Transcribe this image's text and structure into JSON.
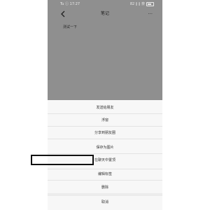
{
  "status_bar": {
    "left": "Tu ⓘ 17:27",
    "right": "82 ∥ ∥ 奈"
  },
  "nav": {
    "title": "笔记",
    "more": "···"
  },
  "note": {
    "content": "测试一下"
  },
  "sheet": {
    "items": [
      {
        "label": "发送给朋友"
      },
      {
        "label": "浮窗"
      },
      {
        "label": "分享到朋友圈"
      },
      {
        "label": "保存为图片"
      },
      {
        "label": "在聊天中置顶"
      },
      {
        "label": "编辑标签"
      },
      {
        "label": "删除"
      }
    ],
    "cancel": "取消"
  }
}
